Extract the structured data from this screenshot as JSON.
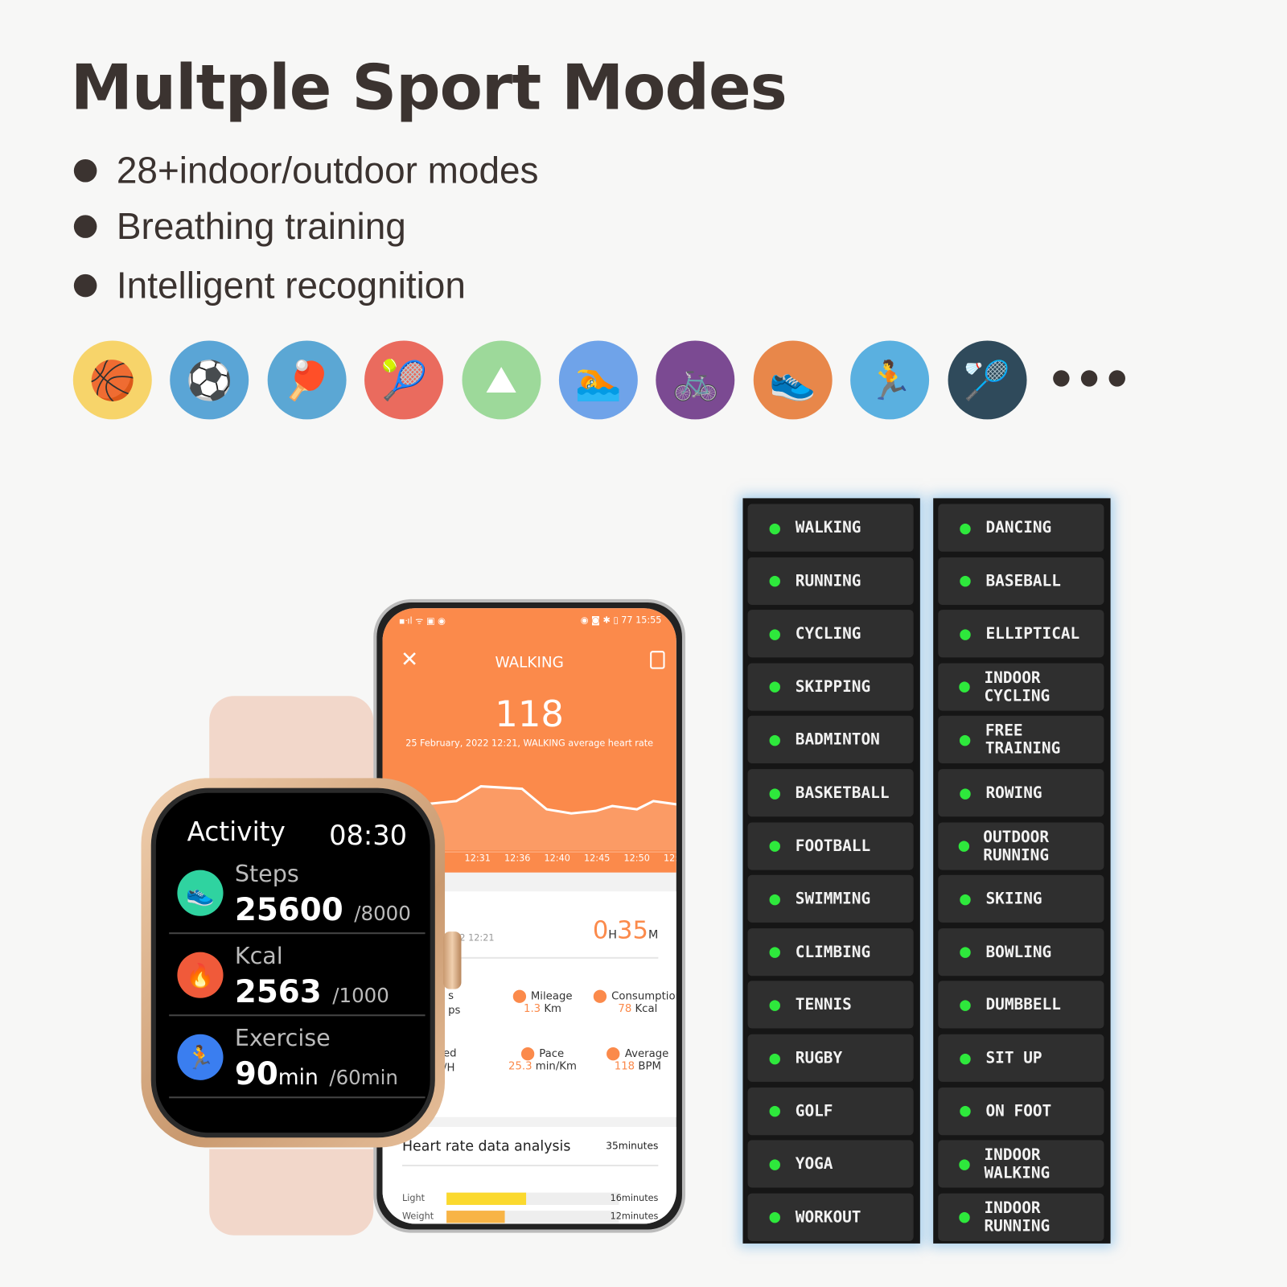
{
  "title": "Multple Sport Modes",
  "bullets": [
    "28+indoor/outdoor modes",
    "Breathing training",
    "Intelligent recognition"
  ],
  "sport_icons": [
    {
      "name": "basketball-icon",
      "glyph": "🏀",
      "color": "#f7d46a"
    },
    {
      "name": "soccer-ball-icon",
      "glyph": "⚽",
      "color": "#5aa5d6"
    },
    {
      "name": "ping-pong-icon",
      "glyph": "🏓",
      "color": "#5ba7d4"
    },
    {
      "name": "tennis-racket-icon",
      "glyph": "🎾",
      "color": "#ea6b5e"
    },
    {
      "name": "climbing-icon",
      "glyph": "⛰",
      "color": "#9dd99a"
    },
    {
      "name": "swimming-icon",
      "glyph": "🏊",
      "color": "#6fa3e9"
    },
    {
      "name": "cycling-icon",
      "glyph": "🚲",
      "color": "#7b4a92"
    },
    {
      "name": "running-shoe-icon",
      "glyph": "👟",
      "color": "#e8874a"
    },
    {
      "name": "treadmill-icon",
      "glyph": "🏃",
      "color": "#5ab0e0"
    },
    {
      "name": "shuttlecock-icon",
      "glyph": "🏸",
      "color": "#2f4a5b"
    }
  ],
  "sport_modes_left": [
    "WALKING",
    "RUNNING",
    "CYCLING",
    "SKIPPING",
    "BADMINTON",
    "BASKETBALL",
    "FOOTBALL",
    "SWIMMING",
    "CLIMBING",
    "TENNIS",
    "RUGBY",
    "GOLF",
    "YOGA",
    "WORKOUT"
  ],
  "sport_modes_right": [
    "DANCING",
    "BASEBALL",
    "ELLIPTICAL",
    "INDOOR CYCLING",
    "FREE TRAINING",
    "ROWING",
    "OUTDOOR RUNNING",
    "SKIING",
    "BOWLING",
    "DUMBBELL",
    "SIT UP",
    "ON FOOT",
    "INDOOR WALKING",
    "INDOOR RUNNING"
  ],
  "accent_green": "#2ee83c",
  "phone": {
    "status_time": "15:55",
    "battery": "77",
    "header_title": "WALKING",
    "avg_hr": "118",
    "subtitle": "25 February, 2022 12:21, WALKING average heart rate",
    "x_ticks": [
      "12:31",
      "12:36",
      "12:40",
      "12:45",
      "12:50",
      "12:5"
    ],
    "date_partial": "022 12:21",
    "duration_h": "0",
    "duration_h_unit": "H",
    "duration_m": "35",
    "duration_m_unit": "M",
    "stats": [
      {
        "label": "Mileage",
        "value": "1.3",
        "unit": "Km"
      },
      {
        "label": "Consumption",
        "value": "78",
        "unit": "Kcal"
      },
      {
        "label": "Pace",
        "value": "25.3",
        "unit": "min/Km"
      },
      {
        "label": "Average",
        "value": "118",
        "unit": "BPM"
      }
    ],
    "partial_left": [
      "s",
      "ps",
      "ed",
      "/H"
    ],
    "hr_analysis_title": "Heart rate data analysis",
    "hr_analysis_total": "35minutes",
    "hr_zones": [
      {
        "label": "Light",
        "value": "16minutes",
        "fraction": 0.46,
        "color": "#fbd92e"
      },
      {
        "label": "Weight",
        "value": "12minutes",
        "fraction": 0.34,
        "color": "#f8b446"
      }
    ],
    "accent": "#fb8a4b"
  },
  "watch": {
    "title": "Activity",
    "time": "08:30",
    "rows": [
      {
        "label": "Steps",
        "value": "25600",
        "unit": "",
        "goal": "/8000",
        "color": "#2fd3a0",
        "glyph": "👟"
      },
      {
        "label": "Kcal",
        "value": "2563",
        "unit": "",
        "goal": "/1000",
        "color": "#f05a3a",
        "glyph": "🔥"
      },
      {
        "label": "Exercise",
        "value": "90",
        "unit": "min",
        "goal": "/60min",
        "color": "#3a7ef0",
        "glyph": "🏃"
      }
    ]
  }
}
